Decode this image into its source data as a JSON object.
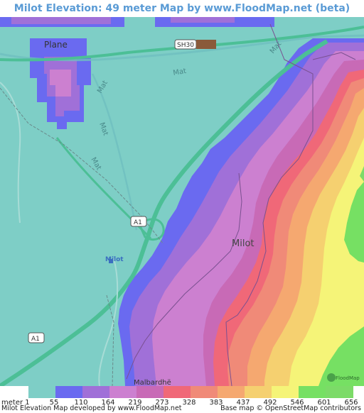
{
  "title": "Milot Elevation: 49 meter Map by www.FloodMap.net (beta)",
  "map_labels": {
    "town_plane": "Plane",
    "town_milot_center": "Milot",
    "town_milot_marker": "Milot",
    "town_malbardhe": "Malbardhë",
    "road_sh30": "SH30",
    "road_a1_upper": "A1",
    "road_a1_lower": "A1",
    "river_mat_1": "Mat",
    "river_mat_2": "Mat",
    "river_mat_3": "Mat",
    "river_mat_4": "Mat",
    "river_mat_5": "Mat",
    "watermark": "FloodMap"
  },
  "legend": {
    "unit_label": "meter 1",
    "ticks": [
      "55",
      "110",
      "164",
      "219",
      "273",
      "328",
      "383",
      "437",
      "492",
      "546",
      "601",
      "656"
    ],
    "colors": [
      "#7ecec6",
      "#6a6af0",
      "#a070d8",
      "#cc80d0",
      "#c86ab6",
      "#f06878",
      "#f08a78",
      "#f5a870",
      "#f5d070",
      "#f5f478",
      "#76e063",
      "#7cdb68"
    ]
  },
  "footer": {
    "left": "Milot Elevation Map developed by www.FloodMap.net",
    "right": "Base map © OpenStreetMap contributors"
  },
  "colors": {
    "lowland": "#7ecec6",
    "road": "#4cbf96",
    "title": "#5a9bd5"
  }
}
